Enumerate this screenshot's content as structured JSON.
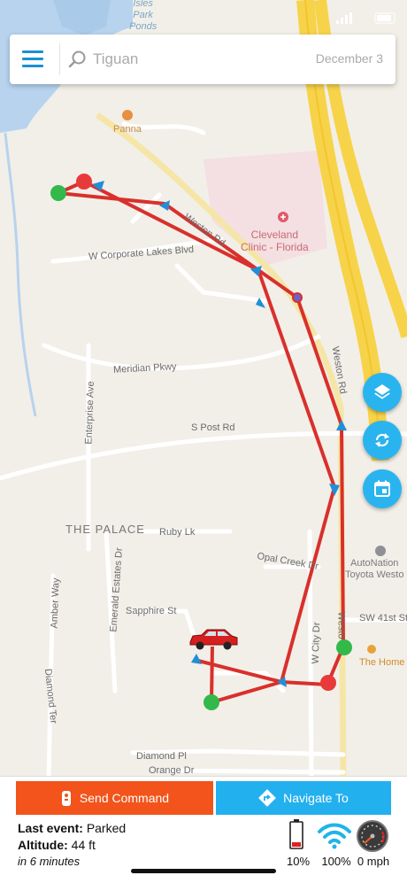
{
  "search": {
    "placeholder": "Tiguan",
    "date": "December 3"
  },
  "map_labels": {
    "isles_park_ponds": "Isles\nPark\nPonds",
    "panna": "Panna",
    "cleveland_clinic": "Cleveland\nClinic - Florida",
    "weston_rd_upper": "Weston Rd",
    "w_corporate_lakes": "W Corporate Lakes Blvd",
    "meridian_pkwy": "Meridian Pkwy",
    "weston_rd_right": "Weston Rd",
    "enterprise_ave": "Enterprise Ave",
    "s_post_rd": "S Post Rd",
    "the_palace": "THE PALACE",
    "ruby_lk": "Ruby Lk",
    "opal_creek_dr": "Opal Creek Dr",
    "autonation": "AutoNation\nToyota Westo",
    "emerald_estates_dr": "Emerald Estates Dr",
    "amber_way": "Amber Way",
    "sapphire_st": "Sapphire St",
    "w_city_dr": "W City Dr",
    "sw_41st_st": "SW 41st St",
    "weston_lower": "Westo",
    "the_home": "The Home",
    "diamond_ter": "Diamond Ter",
    "diamond_pl": "Diamond Pl",
    "orange_dr": "Orange Dr"
  },
  "buttons": {
    "send_command": "Send Command",
    "navigate_to": "Navigate To"
  },
  "status": {
    "last_event_label": "Last event:",
    "last_event_value": "Parked",
    "altitude_label": "Altitude:",
    "altitude_value": "44 ft",
    "when": "in 6 minutes",
    "battery": "10%",
    "signal": "100%",
    "speed": "0 mph"
  },
  "colors": {
    "accent": "#2ab4ef",
    "send": "#f2541b",
    "route": "#d9302c"
  },
  "icons": {
    "menu": "menu-icon",
    "search": "search-icon",
    "layers": "layers-icon",
    "refresh": "refresh-icon",
    "calendar": "calendar-icon",
    "remote": "remote-icon",
    "navigate": "navigate-icon",
    "battery": "battery-icon",
    "wifi": "wifi-icon",
    "speedometer": "speedometer-icon",
    "car": "car-icon"
  }
}
